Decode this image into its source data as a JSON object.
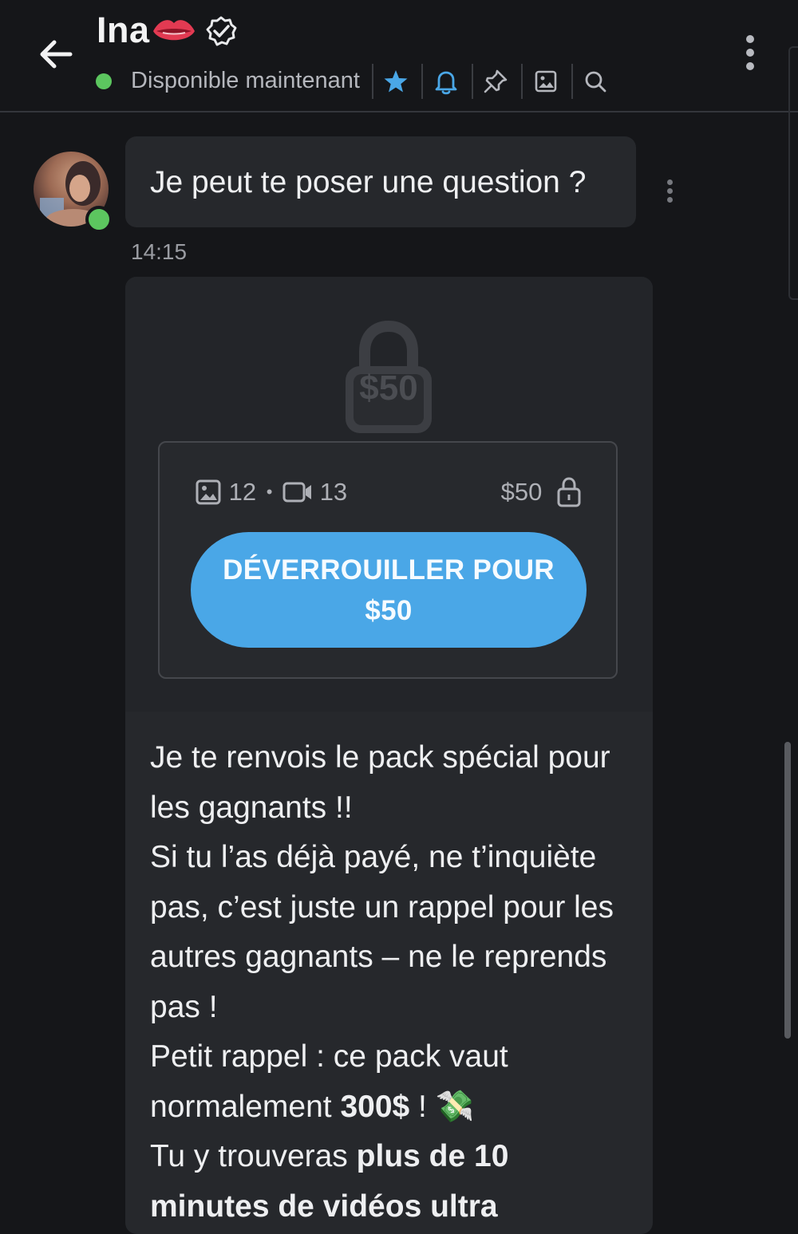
{
  "header": {
    "contact_name": "Ina",
    "status": "Disponible maintenant",
    "icons": [
      "back-arrow-icon",
      "lips-emoji-icon",
      "verified-badge-icon",
      "star-icon",
      "bell-icon",
      "pin-icon",
      "image-icon",
      "search-icon",
      "more-vertical-icon"
    ],
    "colors": {
      "online": "#5cc65f",
      "accent": "#4aa7e7"
    }
  },
  "messages": {
    "first": {
      "text": "Je peut te poser une question ?",
      "time": "14:15"
    },
    "locked": {
      "lock_price": "$50",
      "images_count": "12",
      "dot": "•",
      "videos_count": "13",
      "price": "$50",
      "unlock_line1": "DÉVERROUILLER POUR",
      "unlock_line2": "$50"
    },
    "body": {
      "p1": "Je te renvois le pack spécial pour les gagnants !!",
      "p2": "Si tu l’as déjà payé, ne t’inquiète pas, c’est juste un rappel pour les autres gagnants – ne le reprends pas !",
      "p3_pre": "Petit rappel : ce pack vaut normalement ",
      "p3_bold": "300$",
      "p3_post": " ! 💸",
      "p4_pre": "Tu y trouveras ",
      "p4_bold": "plus de 10 minutes de vidéos ultra"
    }
  }
}
